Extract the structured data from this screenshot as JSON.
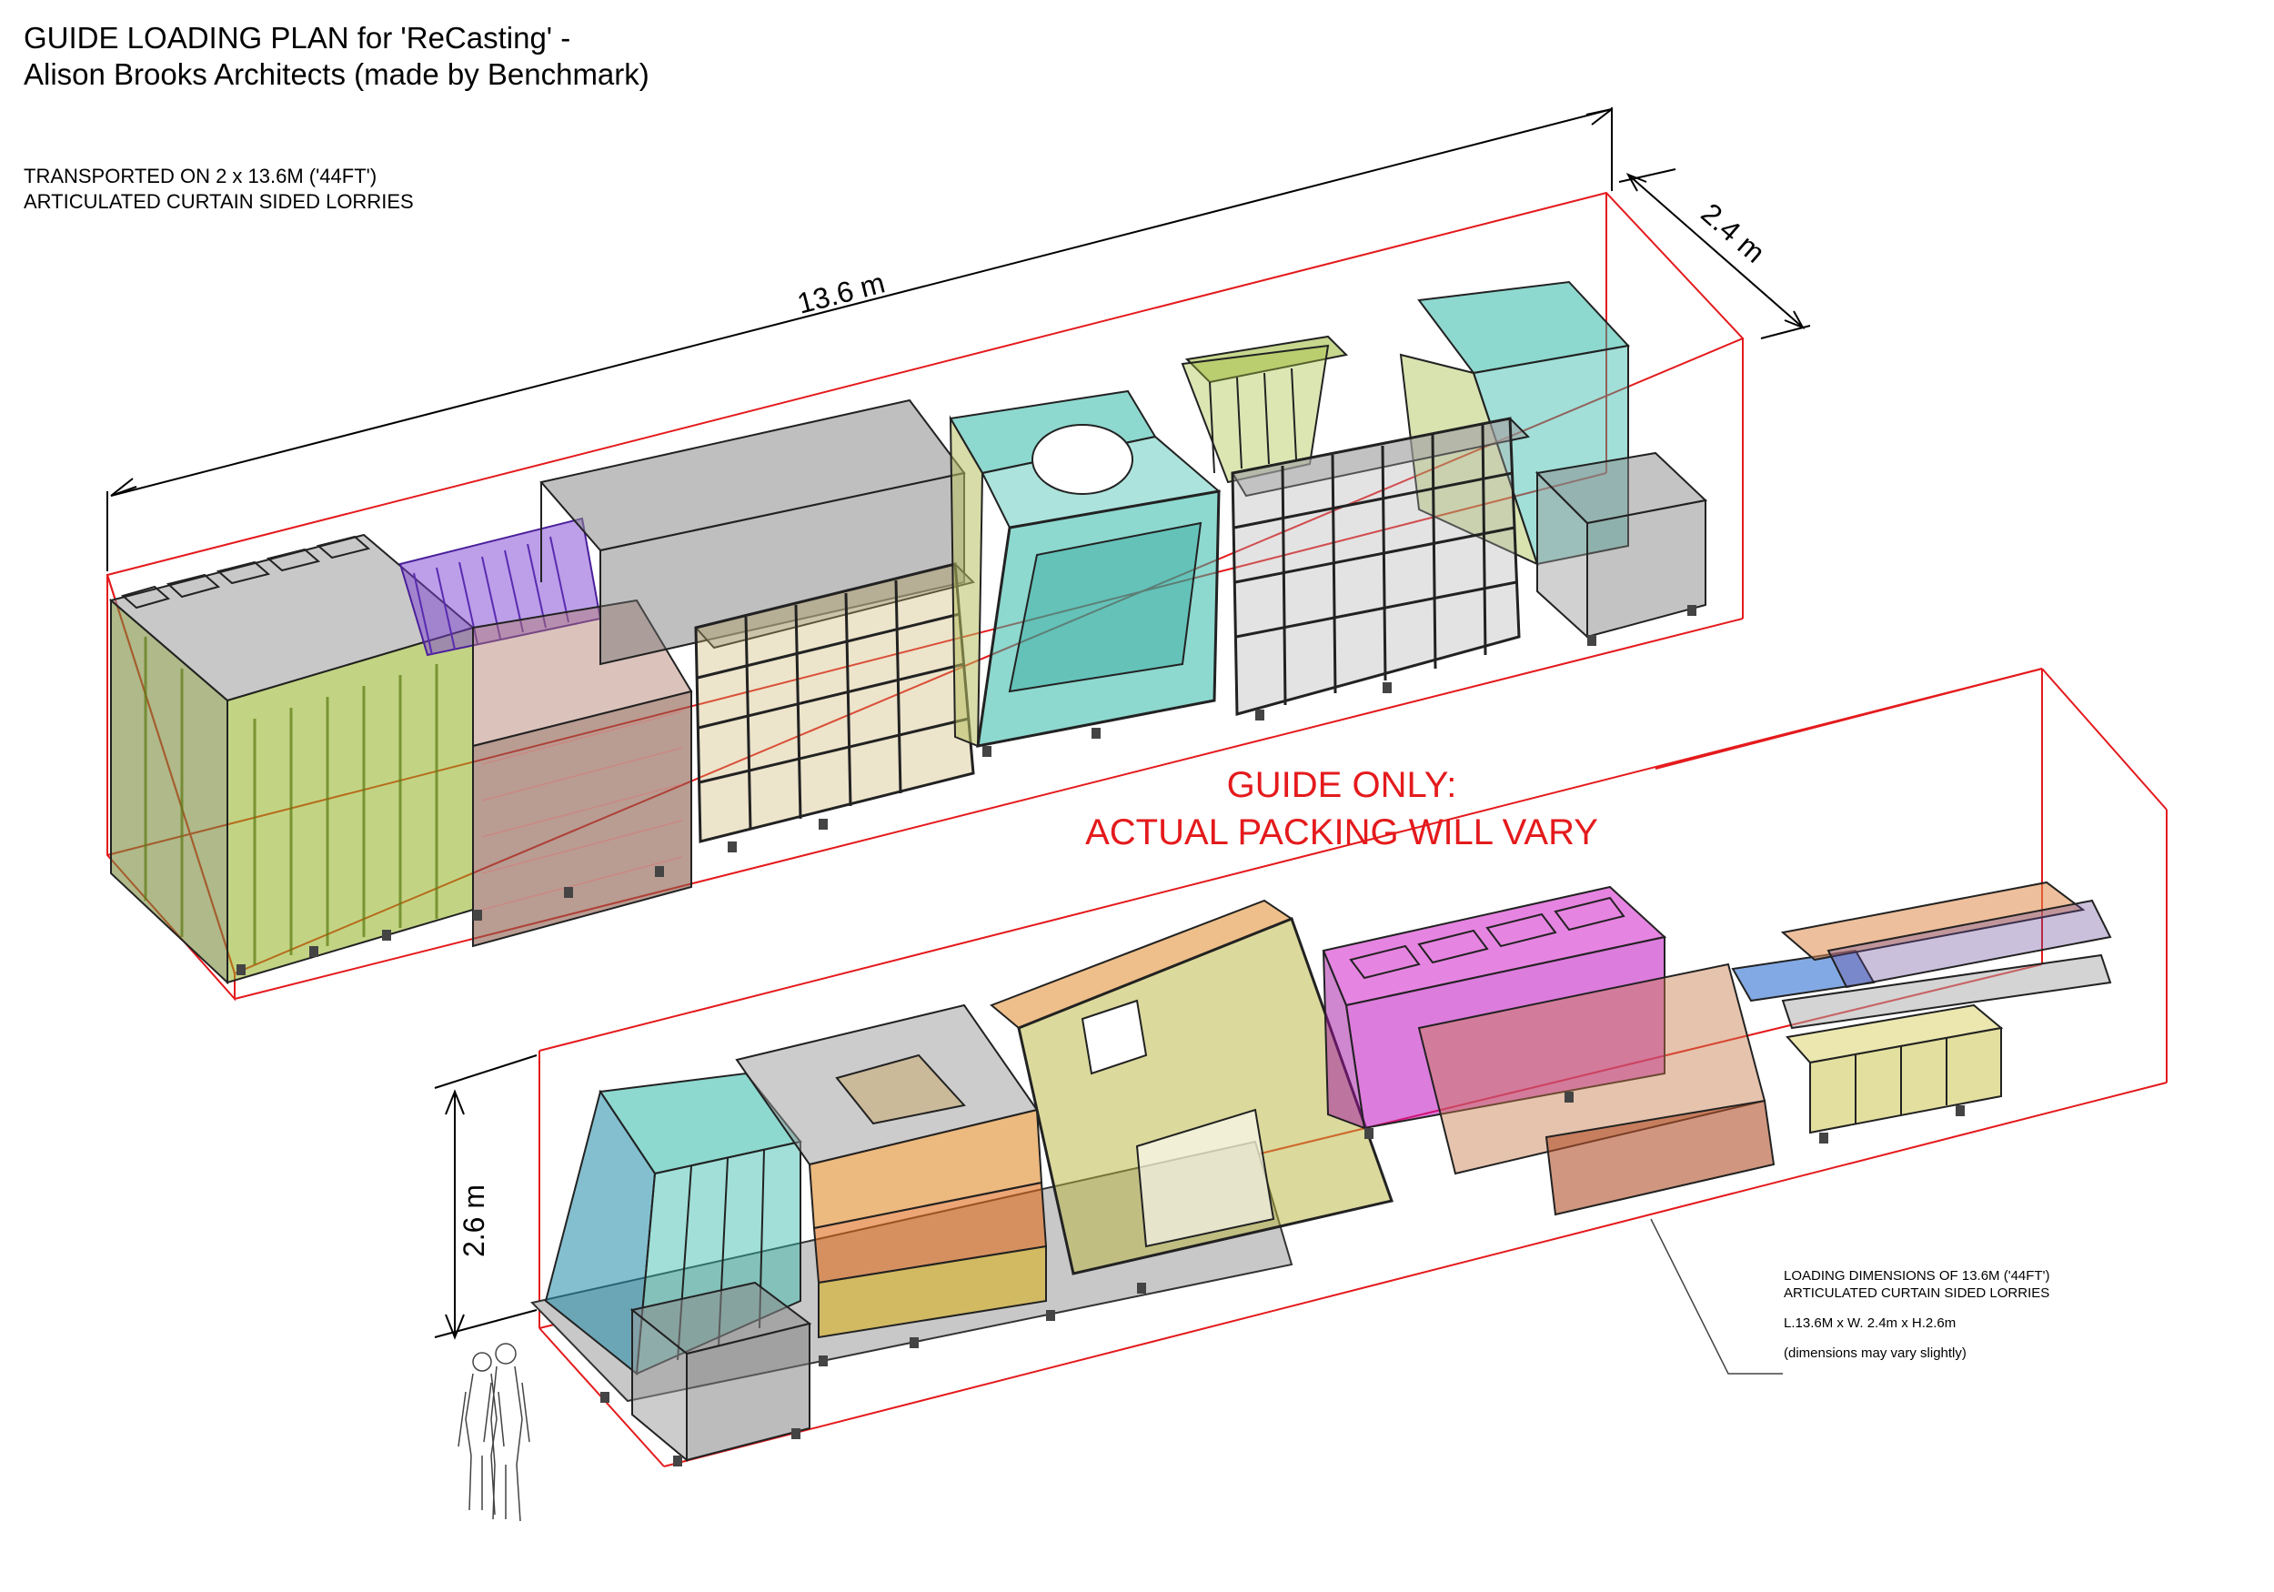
{
  "title": {
    "line1": "GUIDE LOADING PLAN for 'ReCasting' -",
    "line2": "Alison Brooks Architects (made by Benchmark)"
  },
  "transport": {
    "line1": "TRANSPORTED ON 2 x 13.6M ('44FT')",
    "line2": "ARTICULATED CURTAIN SIDED LORRIES"
  },
  "dimensions": {
    "length": "13.6  m",
    "width": "2.4  m",
    "height": "2.6  m"
  },
  "guide_note": {
    "line1": "GUIDE ONLY:",
    "line2": "ACTUAL PACKING WILL VARY"
  },
  "spec": {
    "line1": "LOADING DIMENSIONS OF 13.6M ('44FT')",
    "line2": "ARTICULATED CURTAIN SIDED LORRIES",
    "line3": "L.13.6M x W. 2.4m x H.2.6m",
    "line4": "(dimensions may vary slightly)"
  },
  "colors": {
    "envelope_outline": "#e41a1c",
    "grey_box": "#8a8a8a",
    "green_panels": "#8fb01e",
    "purple_panels": "#7a3fd1",
    "brown_stack": "#8a5a4a",
    "teal": "#2fb8a8",
    "magenta": "#d21fc8",
    "orange": "#e08a2a",
    "olive": "#b8b43a",
    "blue": "#2f6fd0"
  }
}
